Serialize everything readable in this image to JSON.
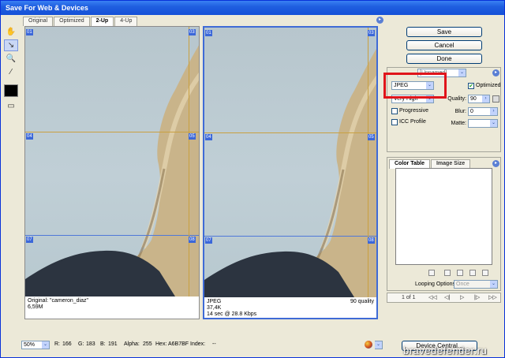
{
  "title": "Save For Web & Devices",
  "tabs": [
    "Original",
    "Optimized",
    "2-Up",
    "4-Up"
  ],
  "tools": {
    "hand": "hand-icon",
    "slice_select": "slice-select-icon",
    "zoom": "zoom-icon",
    "eyedropper": "eyedropper-icon",
    "preview": "browser-preview-icon"
  },
  "slice_tags": [
    "01",
    "02",
    "03",
    "04",
    "05",
    "06",
    "07",
    "08",
    "09"
  ],
  "original_info": {
    "line1": "Original: \"cameron_diaz\"",
    "line2": "6,59M"
  },
  "optimized_info": {
    "format": "JPEG",
    "size": "37,4K",
    "time": "14 sec @ 28.8 Kbps",
    "quality": "90 quality"
  },
  "buttons": {
    "save": "Save",
    "cancel": "Cancel",
    "done": "Done"
  },
  "settings": {
    "preset": "[Unnamed]",
    "format": "JPEG",
    "optimized_label": "Optimized",
    "quality_preset": "Very High",
    "quality_label": "Quality:",
    "quality_value": "90",
    "progressive_label": "Progressive",
    "blur_label": "Blur:",
    "blur_value": "0",
    "icc_label": "ICC Profile",
    "matte_label": "Matte:"
  },
  "color_panel": {
    "tab_color_table": "Color Table",
    "tab_image_size": "Image Size"
  },
  "looping": {
    "label": "Looping Options:",
    "value": "Once"
  },
  "animation": {
    "frame": "1 of 1"
  },
  "status": {
    "zoom": "50%",
    "r": "R:",
    "r_val": "166",
    "g": "G:",
    "g_val": "183",
    "b": "B:",
    "b_val": "191",
    "alpha": "Alpha:",
    "alpha_val": "255",
    "hex": "Hex:",
    "hex_val": "A6B7BF",
    "index": "Index:",
    "index_val": "--"
  },
  "device_central": "Device Central...",
  "watermark": "bravedefender.ru",
  "colors": {
    "accent": "#3b67d9",
    "highlight": "#e0141a",
    "slice_line": "#c9a040"
  }
}
